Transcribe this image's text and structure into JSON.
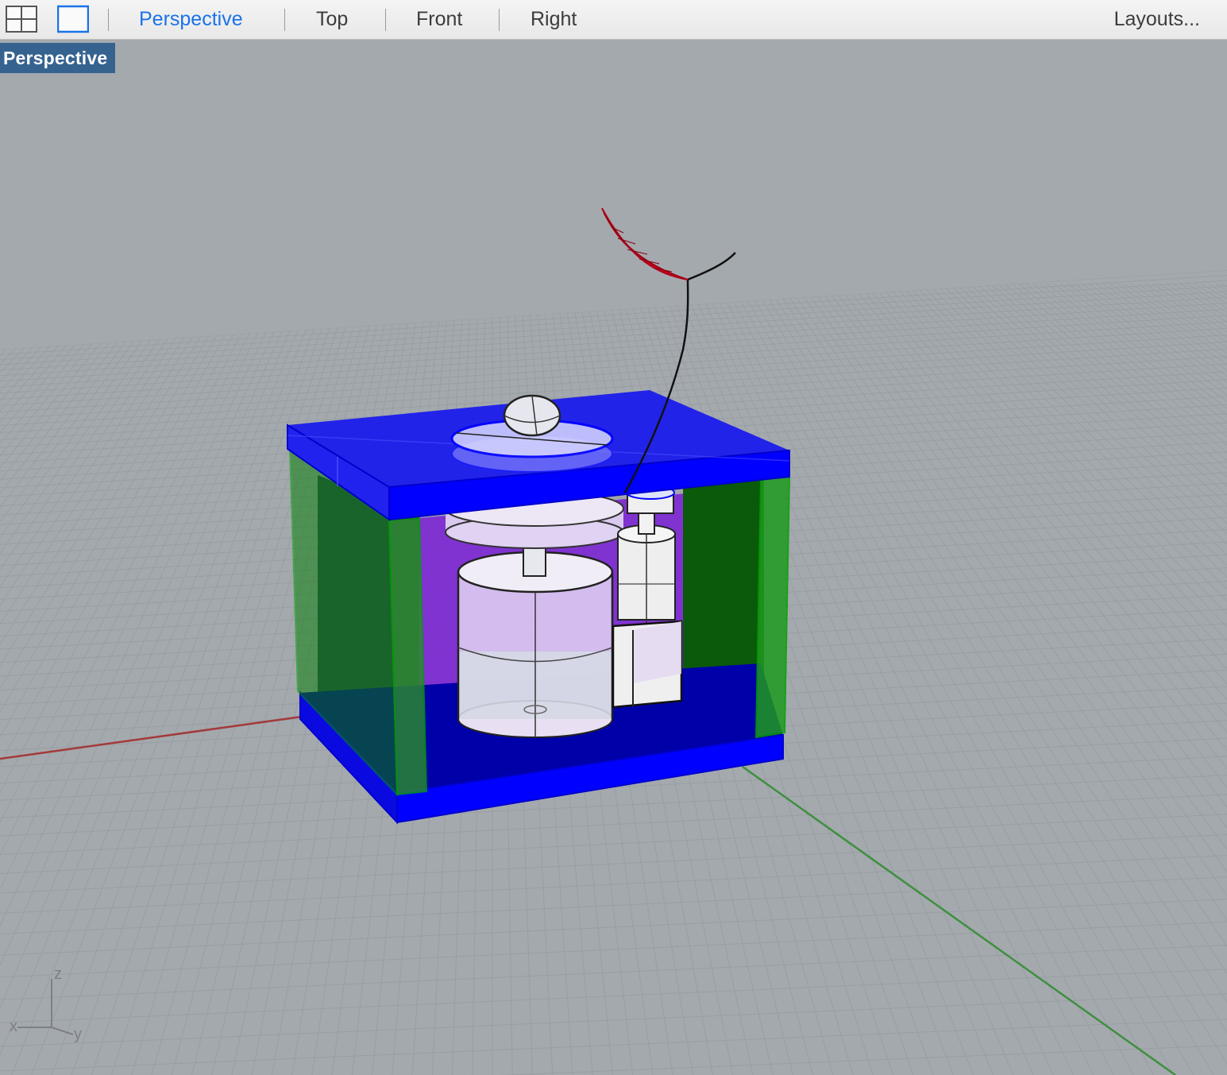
{
  "toolbar": {
    "tabs": [
      {
        "label": "Perspective",
        "active": true
      },
      {
        "label": "Top",
        "active": false
      },
      {
        "label": "Front",
        "active": false
      },
      {
        "label": "Right",
        "active": false
      }
    ],
    "layouts_label": "Layouts...",
    "icons": [
      "four-viewports-icon",
      "single-viewport-icon"
    ]
  },
  "viewport": {
    "label": "Perspective",
    "axis_gizmo": {
      "x": "x",
      "y": "y",
      "z": "z"
    }
  },
  "colors": {
    "active_tab": "#1a73e8",
    "viewport_label_bg": "#36628f",
    "background": "#a4a9ae",
    "grid_line": "#9aa0a5",
    "x_axis": "#a33a3a",
    "y_axis": "#3f8f3f",
    "box_blue": "#0000ff",
    "walls_green": "#008000",
    "interior_purple": "#7a1fd6",
    "leaf_red": "#e00020"
  }
}
